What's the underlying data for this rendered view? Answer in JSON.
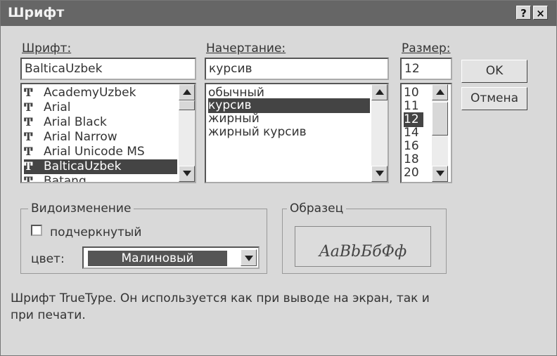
{
  "window": {
    "title": "Шрифт",
    "help_button": "?",
    "close_button": "×"
  },
  "font": {
    "label": "Шрифт:",
    "value": "BalticaUzbek",
    "items": [
      "AcademyUzbek",
      "Arial",
      "Arial Black",
      "Arial Narrow",
      "Arial Unicode MS",
      "BalticaUzbek",
      "Batang"
    ],
    "selected_index": 5,
    "item_icon": "truetype-icon"
  },
  "style": {
    "label": "Начертание:",
    "value": "курсив",
    "items": [
      "обычный",
      "курсив",
      "жирный",
      "жирный курсив"
    ],
    "selected_index": 1
  },
  "size": {
    "label": "Размер:",
    "value": "12",
    "items": [
      "10",
      "11",
      "12",
      "14",
      "16",
      "18",
      "20"
    ],
    "selected_index": 2
  },
  "buttons": {
    "ok": "OK",
    "cancel": "Отмена"
  },
  "effects": {
    "legend": "Видоизменение",
    "underline_label": "подчеркнутый",
    "underline_checked": false,
    "color_label": "цвет:",
    "color_value": "Малиновый"
  },
  "sample": {
    "legend": "Образец",
    "text": "AaBbБбФф"
  },
  "description": {
    "line1": "Шрифт TrueType. Он используется как при выводе на экран, так и",
    "line2": "при печати."
  },
  "colors": {
    "titlebar": "#666666",
    "dialog": "#d9d9d9",
    "selection": "#444444",
    "color_combo_fill": "#555555"
  }
}
